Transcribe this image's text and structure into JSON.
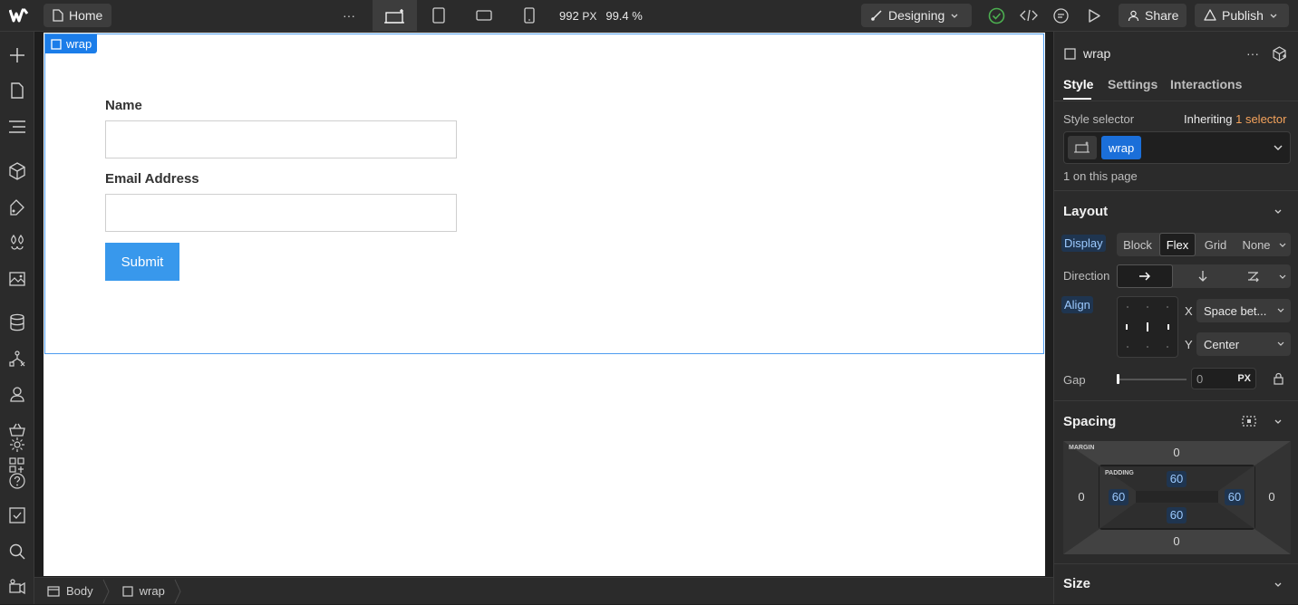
{
  "topbar": {
    "home_label": "Home",
    "more_label": "···",
    "width_value": "992",
    "width_unit": "PX",
    "zoom": "99.4 %",
    "mode_label": "Designing",
    "share_label": "Share",
    "publish_label": "Publish"
  },
  "canvas": {
    "wrap_tag": "wrap",
    "name_label": "Name",
    "email_label": "Email Address",
    "submit_label": "Submit"
  },
  "breadcrumb": {
    "items": [
      "Body",
      "wrap"
    ]
  },
  "panel": {
    "element_name": "wrap",
    "tabs": [
      "Style",
      "Settings",
      "Interactions"
    ],
    "style_selector_label": "Style selector",
    "inheriting_label": "Inheriting",
    "inheriting_count": "1 selector",
    "selector_chip": "wrap",
    "on_page_text": "1 on this page",
    "layout": {
      "title": "Layout",
      "display_label": "Display",
      "display_options": [
        "Block",
        "Flex",
        "Grid",
        "None"
      ],
      "display_selected": "Flex",
      "direction_label": "Direction",
      "align_label": "Align",
      "x_label": "X",
      "x_value": "Space bet...",
      "y_label": "Y",
      "y_value": "Center",
      "gap_label": "Gap",
      "gap_value": "0",
      "gap_unit": "PX"
    },
    "spacing": {
      "title": "Spacing",
      "margin_label": "MARGIN",
      "padding_label": "PADDING",
      "margin_top": "0",
      "margin_right": "0",
      "margin_bottom": "0",
      "margin_left": "0",
      "padding_top": "60",
      "padding_right": "60",
      "padding_bottom": "60",
      "padding_left": "60"
    },
    "size_title": "Size"
  },
  "colors": {
    "accent": "#1b7de9",
    "submit": "#3898ec",
    "inherit_orange": "#f5a35c",
    "panel_bg": "#2b2b2b",
    "active_tab_underline": "#ffffff",
    "success_green": "#4caf50"
  },
  "icons": {
    "logo": "webflow-logo",
    "page": "page-icon",
    "add": "plus-icon",
    "navigator": "navigator-icon",
    "components": "cube-icon",
    "preview": "play-icon"
  }
}
